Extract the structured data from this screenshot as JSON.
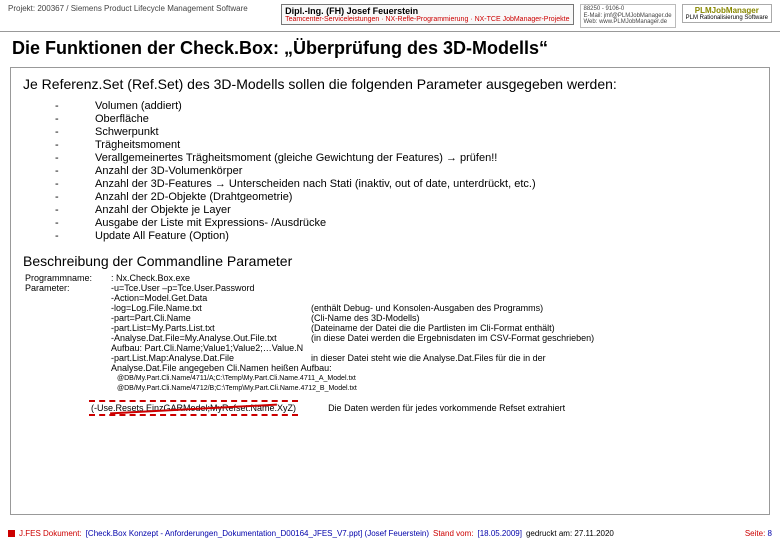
{
  "header": {
    "project": "Projekt: 200367 / Siemens Product Lifecycle Management Software",
    "brand_top": "Dipl.-Ing. (FH) Josef Feuerstein",
    "brand_bot": "Teamcenter-Serviceleistungen · NX-Refle-Programmierung · NX-TCE JobManager-Projekte",
    "details_1": "88250 - 9106-0",
    "details_2": "E-Mail: jmf@PLMJobManager.de",
    "details_3": "Web: www.PLMJobManager.de",
    "logo_top": "PLMJobManager",
    "logo_bot": "PLM Rationalisierung Software"
  },
  "title": "Die Funktionen der Check.Box: „Überprüfung des 3D-Modells“",
  "intro": "Je Referenz.Set (Ref.Set) des 3D-Modells sollen die folgenden Parameter ausgegeben werden:",
  "params": [
    "Volumen (addiert)",
    "Oberfläche",
    "Schwerpunkt",
    "Trägheitsmoment",
    "Verallgemeinertes Trägheitsmoment (gleiche Gewichtung der Features) → prüfen!!",
    "Anzahl der 3D-Volumenkörper",
    "Anzahl der 3D-Features → Unterscheiden nach Stati (inaktiv, out of date, unterdrückt, etc.)",
    "Anzahl der 2D-Objekte (Drahtgeometrie)",
    "Anzahl der Objekte je Layer",
    "Ausgabe der Liste mit Expressions- /Ausdrücke",
    "Update All Feature (Option)"
  ],
  "subhead": "Beschreibung der Commandline Parameter",
  "cmd": {
    "label_prog": "Programmname:",
    "label_param": "Parameter:",
    "prog": ": Nx.Check.Box.exe",
    "lines": [
      {
        "arg": "-u=Tce.User –p=Tce.User.Password",
        "desc": ""
      },
      {
        "arg": "-Action=Model.Get.Data",
        "desc": ""
      },
      {
        "arg": "-log=Log.File.Name.txt",
        "desc": "(enthält Debug- und Konsolen-Ausgaben des Programms)"
      },
      {
        "arg": "-part=Part.Cli.Name",
        "desc": "(Cli-Name des 3D-Modells)"
      },
      {
        "arg": "-part.List=My.Parts.List.txt",
        "desc": "(Dateiname der Datei die die Partlisten im Cli-Format enthält)"
      },
      {
        "arg": "-Analyse.Dat.File=My.Analyse.Out.File.txt",
        "desc": "(in diese Datei werden die Ergebnisdaten im CSV-Format geschrieben)"
      }
    ],
    "aufbau": "Aufbau: Part.Cli.Name;Value1;Value2;…Value.N",
    "map_arg": "-part.List.Map:Analyse.Dat.File",
    "map_desc": "in dieser Datei steht wie die Analyse.Dat.Files für die in der",
    "map_desc2": "Analyse.Dat.File angegeben Cli.Namen heißen Aufbau:",
    "tiny1": "@DB/My.Part.Cli.Name/4711/A;C:\\Temp\\My.Part.Cli.Name.4711_A_Model.txt",
    "tiny2": "@DB/My.Part.Cli.Name/4712/B;C:\\Temp\\My.Part.Cli.Name.4712_B_Model.txt"
  },
  "strike": "(-Use.Resets EinzGARModel;MyRefset.Name.XyZ)",
  "strike_note": "Die Daten werden für jedes vorkommende Refset extrahiert",
  "footer": {
    "doc": "J.FES Dokument:",
    "file": "[Check.Box Konzept - Anforderungen_Dokumentation_D00164_JFES_V7.ppt] (Josef Feuerstein)",
    "stand_lbl": "Stand vom:",
    "stand_val": "[18.05.2009]",
    "printed": "gedruckt am: 27.11.2020",
    "page_lbl": "Seite:",
    "page_no": "8"
  }
}
